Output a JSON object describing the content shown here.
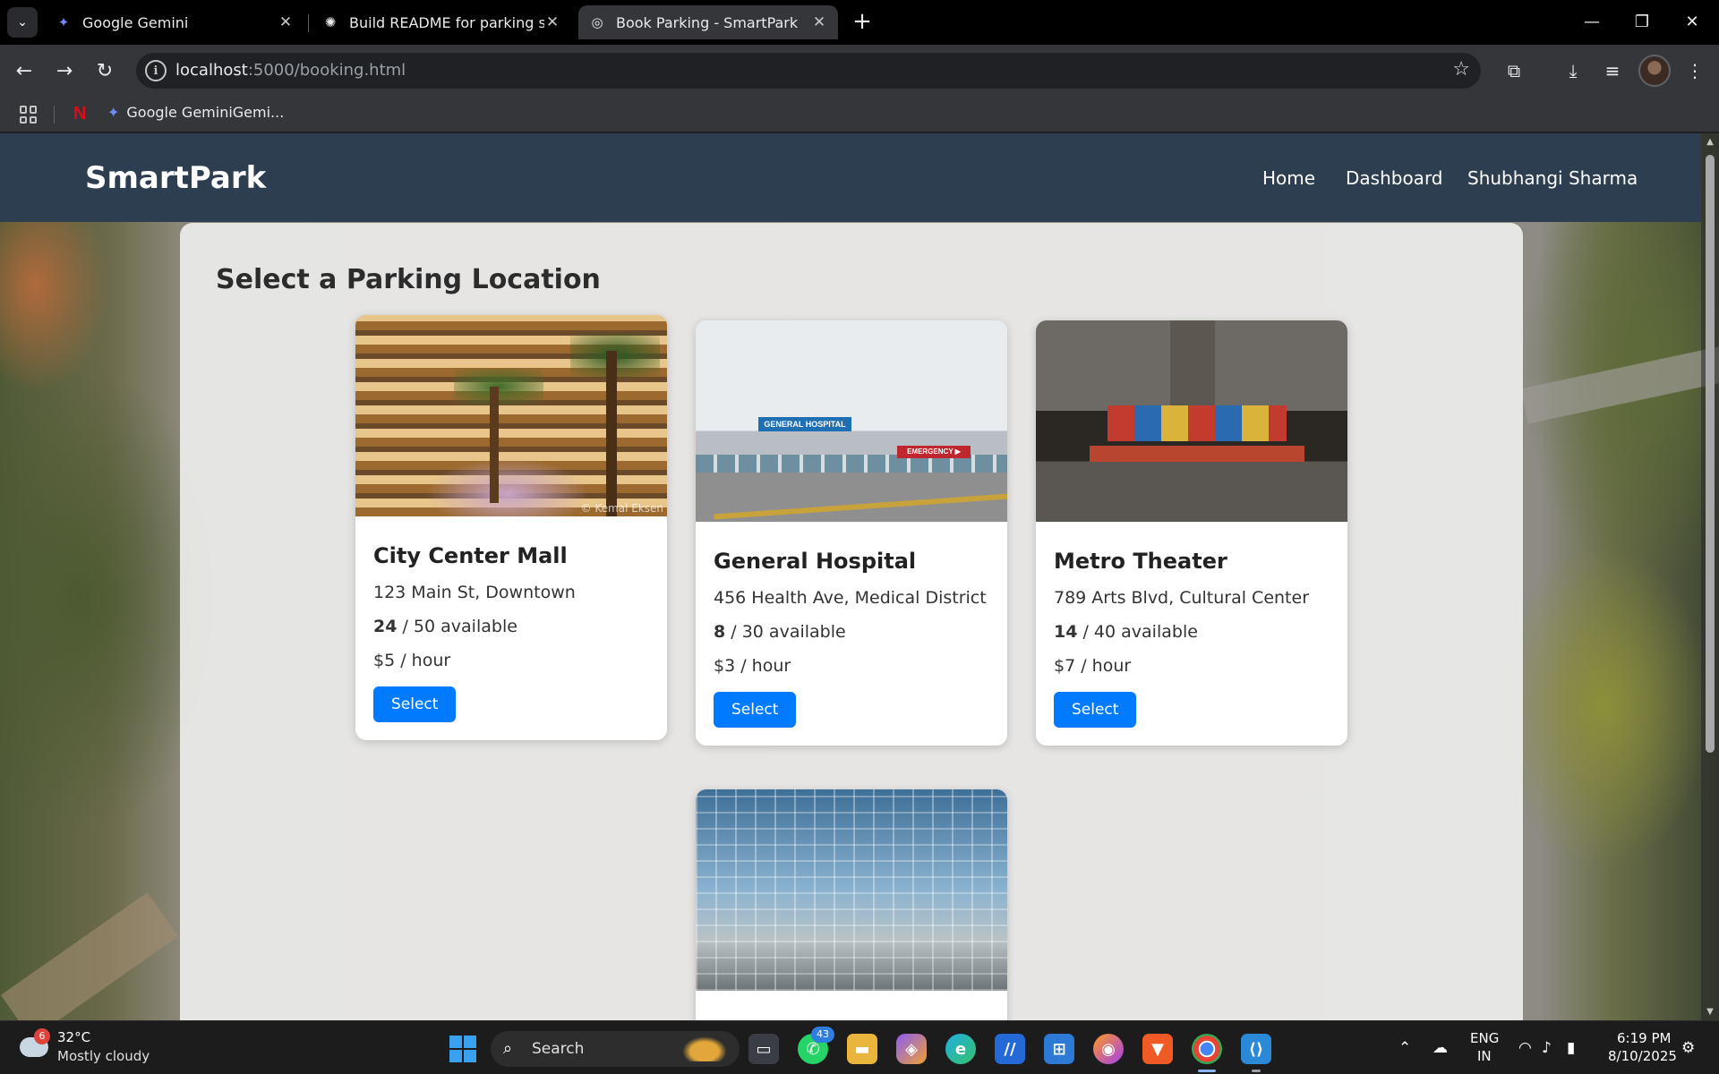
{
  "browser": {
    "tabs": [
      {
        "title": "Google Gemini",
        "favicon": "gemini-icon",
        "active": false
      },
      {
        "title": "Build README for parking syste",
        "favicon": "openai-icon",
        "active": false
      },
      {
        "title": "Book Parking - SmartPark",
        "favicon": "globe-icon",
        "active": true
      }
    ],
    "url_host": "localhost",
    "url_path": ":5000/booking.html",
    "bookmarks": [
      {
        "label": "",
        "icon": "netflix-icon"
      },
      {
        "label": "Google GeminiGemi...",
        "icon": "gemini-icon"
      }
    ]
  },
  "navbar": {
    "brand": "SmartPark",
    "links": [
      "Home",
      "Dashboard",
      "Shubhangi Sharma"
    ]
  },
  "page": {
    "title": "Select a Parking Location",
    "select_label": "Select",
    "locations": [
      {
        "name": "City Center Mall",
        "address": "123 Main St, Downtown",
        "available": "24",
        "total_text": " / 50 available",
        "price": "$5 / hour",
        "image": "mall-photo",
        "watermark": "© Kemal Eksen"
      },
      {
        "name": "General Hospital",
        "address": "456 Health Ave, Medical District",
        "available": "8",
        "total_text": " / 30 available",
        "price": "$3 / hour",
        "image": "hospital-photo",
        "sign": "GENERAL HOSPITAL",
        "sign2": "EMERGENCY ▶"
      },
      {
        "name": "Metro Theater",
        "address": "789 Arts Blvd, Cultural Center",
        "available": "14",
        "total_text": " / 40 available",
        "price": "$7 / hour",
        "image": "theater-photo"
      },
      {
        "name": "",
        "address": "",
        "available": "",
        "total_text": "",
        "price": "",
        "image": "transit-station-photo"
      }
    ]
  },
  "taskbar": {
    "weather_temp": "32°C",
    "weather_desc": "Mostly cloudy",
    "weather_badge": "6",
    "search_label": "Search",
    "whatsapp_badge": "43",
    "lang_line1": "ENG",
    "lang_line2": "IN",
    "time": "6:19 PM",
    "date": "8/10/2025"
  },
  "colors": {
    "navbar": "#2c3e50",
    "button": "#007bff",
    "tab_active": "#35363a"
  }
}
